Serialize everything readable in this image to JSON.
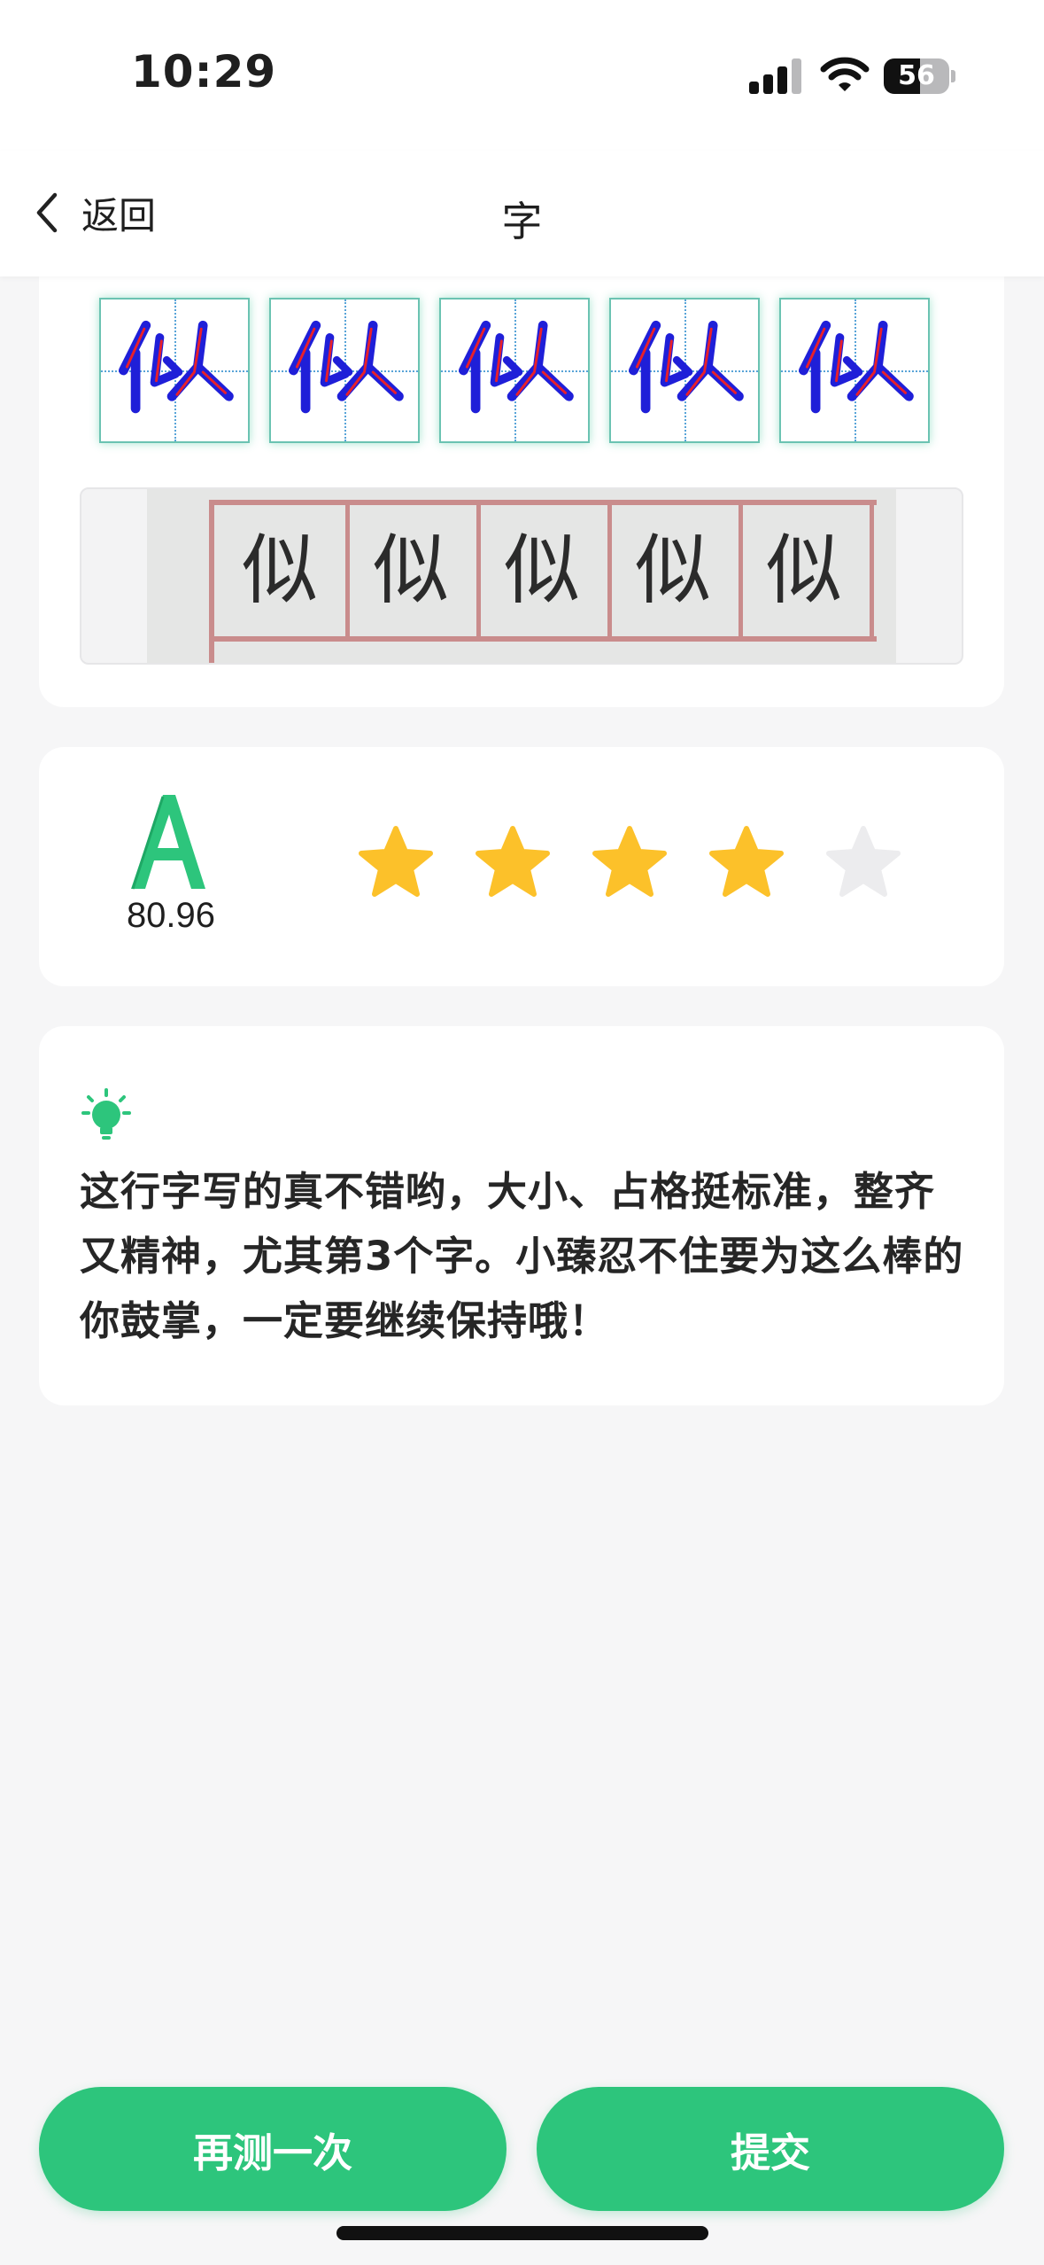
{
  "status_bar": {
    "time": "10:29",
    "battery": "56",
    "battery_level": 0.56
  },
  "nav": {
    "back_label": "返回",
    "title": "字"
  },
  "practice": {
    "character": "似",
    "cell_count": 5,
    "photo_chars": [
      "似",
      "似",
      "似",
      "似",
      "似"
    ]
  },
  "score": {
    "grade": "A",
    "value": "80.96",
    "stars_filled": 4,
    "stars_total": 5
  },
  "feedback": {
    "icon": "lightbulb-icon",
    "text": "这行字写的真不错哟，大小、占格挺标准，整齐又精神，尤其第3个字。小臻忍不住要为这么棒的你鼓掌，一定要继续保持哦！"
  },
  "buttons": {
    "retry_label": "再测一次",
    "submit_label": "提交"
  },
  "colors": {
    "accent": "#2dc57c",
    "star_on": "#fcc12a",
    "star_off": "#ececee",
    "stroke_blue": "#1f1fd8",
    "stroke_red": "#e8202a"
  }
}
